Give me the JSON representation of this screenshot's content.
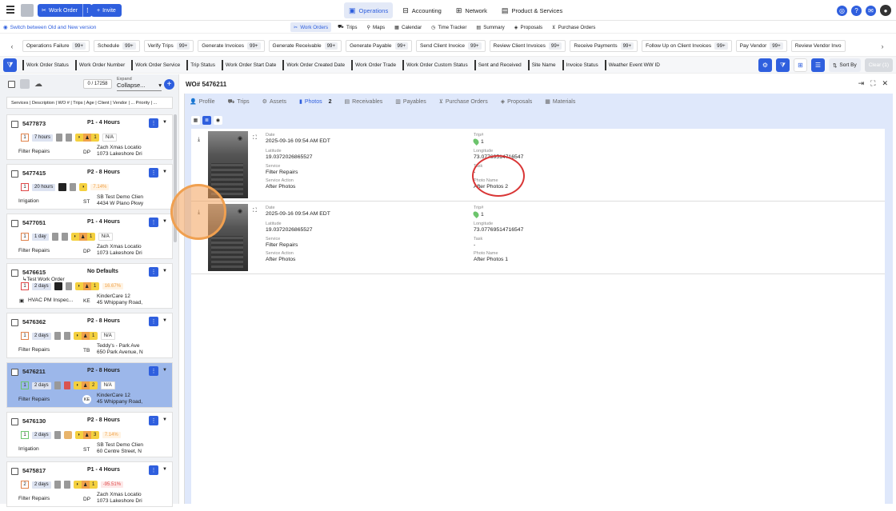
{
  "topbar": {
    "work_order_label": "Work Order",
    "invite_label": "Invite",
    "modules": [
      {
        "label": "Operations",
        "active": true,
        "icon": "operations-icon"
      },
      {
        "label": "Accounting",
        "active": false,
        "icon": "accounting-icon"
      },
      {
        "label": "Network",
        "active": false,
        "icon": "network-icon"
      },
      {
        "label": "Product & Services",
        "active": false,
        "icon": "product-icon"
      }
    ]
  },
  "switch_label": "Switch between Old and New version",
  "subnav": [
    "Work Orders",
    "Trips",
    "Maps",
    "Calendar",
    "Time Tracker",
    "Summary",
    "Proposals",
    "Purchase Orders"
  ],
  "chips": [
    {
      "label": "Operations Failure",
      "count": "99+"
    },
    {
      "label": "Schedule",
      "count": "99+"
    },
    {
      "label": "Verify Trips",
      "count": "99+"
    },
    {
      "label": "Generate Invoices",
      "count": "99+"
    },
    {
      "label": "Generate Receivable",
      "count": "99+"
    },
    {
      "label": "Generate Payable",
      "count": "99+"
    },
    {
      "label": "Send Client Invoice",
      "count": "99+"
    },
    {
      "label": "Review Client Invoices",
      "count": "99+"
    },
    {
      "label": "Receive Payments",
      "count": "99+"
    },
    {
      "label": "Follow Up on Client Invoices",
      "count": "99+"
    },
    {
      "label": "Pay Vendor",
      "count": "99+"
    },
    {
      "label": "Review Vendor Invo",
      "count": ""
    }
  ],
  "columns": [
    "Work Order Status",
    "Work Order Number",
    "Work Order Service",
    "Trip Status",
    "Work Order Start Date",
    "Work Order Created Date",
    "Work Order Trade",
    "Work Order Custom Status",
    "Sent and Received",
    "Site Name",
    "Invoice Status",
    "Weather Event WW ID"
  ],
  "sort_label": "Sort By",
  "clear_label": "Clear (1)",
  "left": {
    "count": "0 / 17258",
    "expand_label": "Expand",
    "expand_value": "Collapse...",
    "header": "Services | Description | WO # | Trips | Age | Client | Vendor | ... Priority | ..."
  },
  "cards": [
    {
      "num": "5477873",
      "sub": "",
      "pri": "P1 - 4 Hours",
      "trips": "1",
      "age": "7 hours",
      "ybnum": "1",
      "pct": "N/A",
      "svc": "Filter Repairs",
      "av": "DP",
      "loc1": "Zach Xmas Locatio",
      "loc2": "1073 Lakeshore Dri"
    },
    {
      "num": "5477415",
      "sub": "",
      "pri": "P2 - 8 Hours",
      "trips": "1",
      "age": "20 hours",
      "ybnum": "",
      "pct": "7.14%",
      "svc": "Irrigation",
      "av": "ST",
      "loc1": "SB Test Demo Clien",
      "loc2": "4434 W Plano Pkwy"
    },
    {
      "num": "5477051",
      "sub": "",
      "pri": "P1 - 4 Hours",
      "trips": "1",
      "age": "1 day",
      "ybnum": "1",
      "pct": "N/A",
      "svc": "Filter Repairs",
      "av": "DP",
      "loc1": "Zach Xmas Locatio",
      "loc2": "1073 Lakeshore Dri"
    },
    {
      "num": "5476615",
      "sub": "Test Work Order",
      "pri": "No Defaults",
      "trips": "1",
      "age": "2 days",
      "ybnum": "1",
      "pct": "16.67%",
      "svc": "HVAC PM Inspec...",
      "av": "KE",
      "loc1": "KinderCare 12",
      "loc2": "45 Whippany Road,"
    },
    {
      "num": "5476362",
      "sub": "",
      "pri": "P2 - 8 Hours",
      "trips": "1",
      "age": "2 days",
      "ybnum": "1",
      "pct": "N/A",
      "svc": "Filter Repairs",
      "av": "TB",
      "loc1": "Teddy's - Park Ave",
      "loc2": "650 Park Avenue, N"
    },
    {
      "num": "5476211",
      "sub": "",
      "pri": "P2 - 8 Hours",
      "trips": "1",
      "age": "2 days",
      "ybnum": "2",
      "pct": "N/A",
      "svc": "Filter Repairs",
      "av": "KE",
      "loc1": "KinderCare 12",
      "loc2": "45 Whippany Road,"
    },
    {
      "num": "5476130",
      "sub": "",
      "pri": "P2 - 8 Hours",
      "trips": "1",
      "age": "2 days",
      "ybnum": "3",
      "pct": "7.14%",
      "svc": "Irrigation",
      "av": "ST",
      "loc1": "SB Test Demo Clien",
      "loc2": "60 Centre Street, N"
    },
    {
      "num": "5475817",
      "sub": "",
      "pri": "P1 - 4 Hours",
      "trips": "2",
      "age": "2 days",
      "ybnum": "1",
      "pct": "-95.51%",
      "svc": "Filter Repairs",
      "av": "DP",
      "loc1": "Zach Xmas Locatio",
      "loc2": "1073 Lakeshore Dri"
    }
  ],
  "detail": {
    "title": "WO# 5476211",
    "tabs": [
      {
        "label": "Profile"
      },
      {
        "label": "Trips"
      },
      {
        "label": "Assets"
      },
      {
        "label": "Photos",
        "badge": "2",
        "active": true
      },
      {
        "label": "Receivables"
      },
      {
        "label": "Payables"
      },
      {
        "label": "Purchase Orders"
      },
      {
        "label": "Proposals"
      },
      {
        "label": "Materials"
      }
    ],
    "photos": [
      {
        "date": "2025-09-16 09:54 AM EDT",
        "lat": "19.0372026865527",
        "service": "Filter Repairs",
        "action": "After Photos",
        "trip": "1",
        "long": "73.07769514716547",
        "task": "-",
        "photo_name": "After Photos 2"
      },
      {
        "date": "2025-09-16 09:54 AM EDT",
        "lat": "19.0372026865527",
        "service": "Filter Repairs",
        "action": "After Photos",
        "trip": "1",
        "long": "73.07769514716547",
        "task": "-",
        "photo_name": "After Photos 1"
      }
    ],
    "labels": {
      "date": "Date",
      "lat": "Latitude",
      "service": "Service",
      "action": "Service Action",
      "trip": "Trip#",
      "long": "Longitude",
      "task": "Task",
      "photo_name": "Photo Name"
    }
  }
}
